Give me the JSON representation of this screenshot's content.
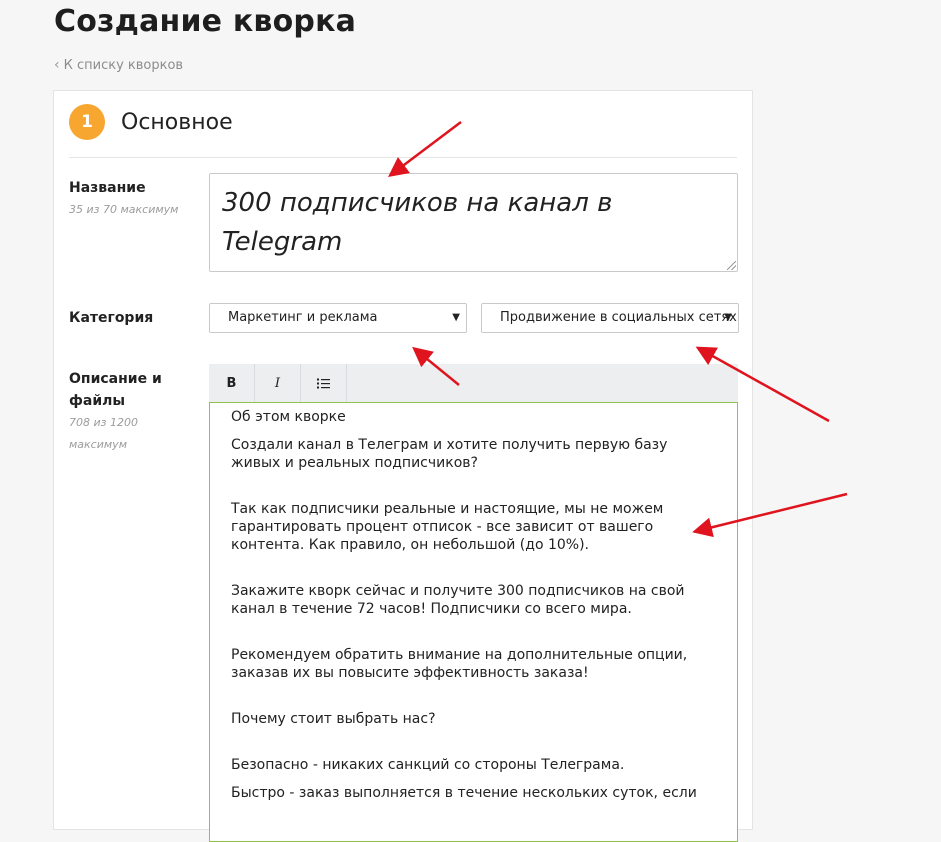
{
  "page": {
    "title": "Создание кворка",
    "back_link": "К списку кворков"
  },
  "section": {
    "number": "1",
    "title": "Основное"
  },
  "fields": {
    "name": {
      "label": "Название",
      "hint": "35 из 70 максимум",
      "value": "300 подписчиков на канал в Telegram"
    },
    "category": {
      "label": "Категория",
      "primary": "Маркетинг и реклама",
      "secondary": "Продвижение в социальных сетях"
    },
    "description": {
      "label_line1": "Описание и",
      "label_line2": "файлы",
      "hint_line1": "708 из 1200",
      "hint_line2": "максимум",
      "toolbar": {
        "bold": "B",
        "italic": "I",
        "list_icon": "bulleted-list-icon"
      },
      "paragraphs": [
        "Об этом кворке",
        "Создали канал в Телеграм и хотите получить первую базу живых и реальных подписчиков?",
        "Так как подписчики реальные и настоящие, мы не можем гарантировать процент отписок - все зависит от вашего контента. Как правило, он небольшой (до 10%).",
        "Закажите кворк сейчас и получите 300 подписчиков на свой канал в течение 72 часов! Подписчики со всего мира.",
        "Рекомендуем обратить внимание на дополнительные опции, заказав их вы повысите эффективность заказа!",
        "Почему стоит выбрать нас?",
        "Безопасно - никаких санкций со стороны Телеграма.",
        "Быстро - заказ выполняется в течение нескольких суток, если"
      ]
    }
  },
  "colors": {
    "badge": "#f7a630",
    "annotation_arrow": "#e0141e",
    "editor_border": "#8fc24a"
  }
}
